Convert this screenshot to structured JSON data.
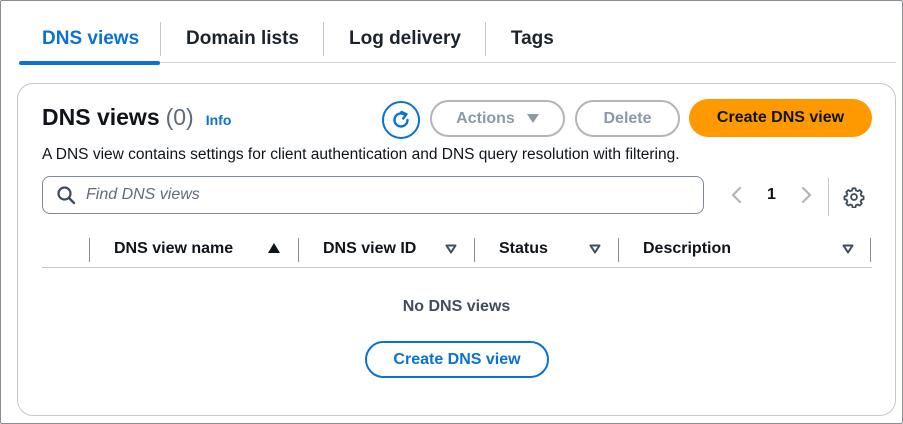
{
  "tabs": [
    {
      "label": "DNS views",
      "active": true
    },
    {
      "label": "Domain lists",
      "active": false
    },
    {
      "label": "Log delivery",
      "active": false
    },
    {
      "label": "Tags",
      "active": false
    }
  ],
  "header": {
    "title": "DNS views",
    "count": "(0)",
    "info": "Info",
    "description": "A DNS view contains settings for client authentication and DNS query resolution with filtering.",
    "actions_label": "Actions",
    "delete_label": "Delete",
    "create_label": "Create DNS view"
  },
  "search": {
    "placeholder": "Find DNS views",
    "value": ""
  },
  "pagination": {
    "current_page": "1"
  },
  "table": {
    "columns": [
      "DNS view name",
      "DNS view ID",
      "Status",
      "Description"
    ],
    "empty_text": "No DNS views",
    "empty_create_label": "Create DNS view"
  },
  "colors": {
    "accent": "#0972d3",
    "primary_button": "#ff9900",
    "disabled": "#8d99a8"
  },
  "icons": {
    "refresh": "refresh-icon",
    "search": "search-icon",
    "settings": "gear-icon",
    "prev": "chevron-left-icon",
    "next": "chevron-right-icon"
  }
}
